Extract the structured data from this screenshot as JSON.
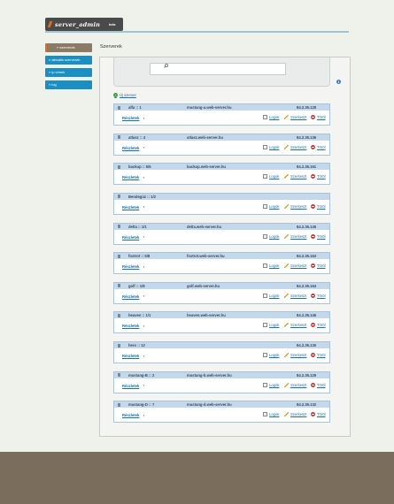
{
  "logo": {
    "text": "server_admin",
    "tag": "beta"
  },
  "nav": {
    "items": [
      {
        "label": "» szerverek",
        "active": true
      },
      {
        "label": "» aktuális szerverek",
        "active": false
      },
      {
        "label": "» ip címek",
        "active": false
      },
      {
        "label": "» log",
        "active": false
      }
    ]
  },
  "page": {
    "title": "Szerverek"
  },
  "search": {
    "value": "",
    "placeholder": ""
  },
  "actions": {
    "add_server": "Új szerver"
  },
  "labels": {
    "details": "Részletek",
    "logs": "Logok",
    "edit": "Szerkeszt",
    "delete": "Töröl"
  },
  "colors": {
    "nav_blue": "#1b8fc2",
    "active_orange": "#d9701f",
    "footer": "#7a6d5b",
    "card_header": "#c3d8ea"
  },
  "servers": [
    {
      "name": "alfa :: 1",
      "host": "mustang-a.web-server.hu",
      "ip": "84.2.35.128"
    },
    {
      "name": "atlasz :: 4",
      "host": "atlasz.web-server.hu",
      "ip": "84.2.35.136"
    },
    {
      "name": "backup :: 5/6",
      "host": "backup.web-server.hu",
      "ip": "84.2.35.161"
    },
    {
      "name": "Bendegúz :: 1/2",
      "host": "",
      "ip": ""
    },
    {
      "name": "delta :: 1/1",
      "host": "delta.web-server.hu",
      "ip": "84.2.35.145"
    },
    {
      "name": "foxtrot :: 5/8",
      "host": "foxtrot.web-server.hu",
      "ip": "84.2.35.163"
    },
    {
      "name": "golf :: 1/8",
      "host": "golf.web-server.hu",
      "ip": "84.2.35.164"
    },
    {
      "name": "heaven :: 1/1",
      "host": "heaven.web-server.hu",
      "ip": "84.2.35.146"
    },
    {
      "name": "hero :: 12",
      "host": "",
      "ip": "84.2.35.130"
    },
    {
      "name": "mustang-B :: 2",
      "host": "mustang-b.web-server.hu",
      "ip": "84.2.35.129"
    },
    {
      "name": "mustang-D :: 7",
      "host": "mustang-d.web-server.hu",
      "ip": "84.2.35.132"
    }
  ]
}
